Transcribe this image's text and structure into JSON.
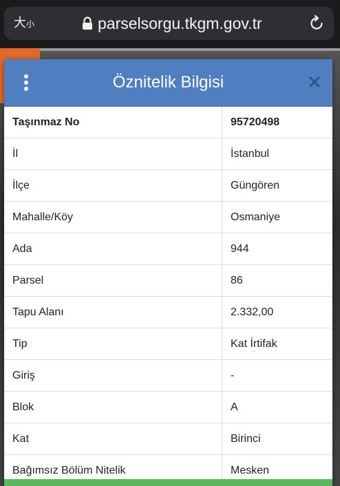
{
  "browser": {
    "text_size_big": "大",
    "text_size_small": "小",
    "url": "parselsorgu.tkgm.gov.tr"
  },
  "dialog": {
    "title": "Öznitelik Bilgisi",
    "header_color": "#4f7fc1",
    "rows": [
      {
        "key": "Taşınmaz No",
        "value": "95720498"
      },
      {
        "key": "İl",
        "value": "İstanbul"
      },
      {
        "key": "İlçe",
        "value": "Güngören"
      },
      {
        "key": "Mahalle/Köy",
        "value": "Osmaniye"
      },
      {
        "key": "Ada",
        "value": "944"
      },
      {
        "key": "Parsel",
        "value": "86"
      },
      {
        "key": "Tapu Alanı",
        "value": "2.332,00"
      },
      {
        "key": "Tip",
        "value": "Kat İrtifak"
      },
      {
        "key": "Giriş",
        "value": "-"
      },
      {
        "key": "Blok",
        "value": "A"
      },
      {
        "key": "Kat",
        "value": "Birinci"
      },
      {
        "key": "Bağımsız Bölüm Nitelik",
        "value": "Mesken"
      }
    ]
  }
}
